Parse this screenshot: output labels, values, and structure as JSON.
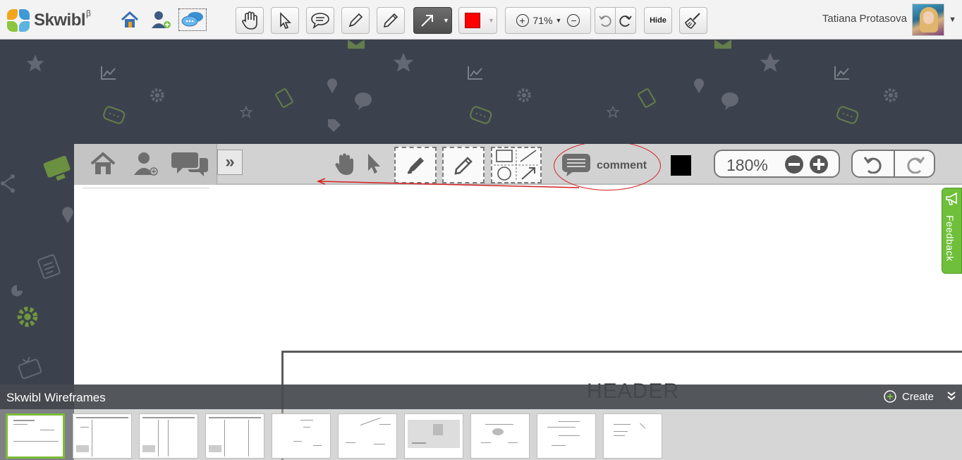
{
  "app": {
    "name": "Skwibl",
    "version_mark": "β",
    "colors": {
      "accent_red": "#ff0000",
      "feedback_green": "#6fbf3a",
      "thumb_selected": "#7dbb3c"
    }
  },
  "toolbar": {
    "zoom_value": "71%",
    "hide_label": "Hide",
    "active_tool": "arrow-tool",
    "current_color": "#ff0000"
  },
  "user": {
    "name": "Tatiana Protasova"
  },
  "canvas": {
    "comment_label": "comment",
    "zoom_value": "180%",
    "header_text": "HEADER"
  },
  "feedback": {
    "label": "Feedback"
  },
  "project": {
    "name": "Skwibl Wireframes",
    "create_label": "Create",
    "thumbnails": [
      {
        "id": 1,
        "selected": true
      },
      {
        "id": 2,
        "selected": false
      },
      {
        "id": 3,
        "selected": false
      },
      {
        "id": 4,
        "selected": false
      },
      {
        "id": 5,
        "selected": false
      },
      {
        "id": 6,
        "selected": false
      },
      {
        "id": 7,
        "selected": false
      },
      {
        "id": 8,
        "selected": false
      },
      {
        "id": 9,
        "selected": false
      },
      {
        "id": 10,
        "selected": false
      }
    ]
  }
}
